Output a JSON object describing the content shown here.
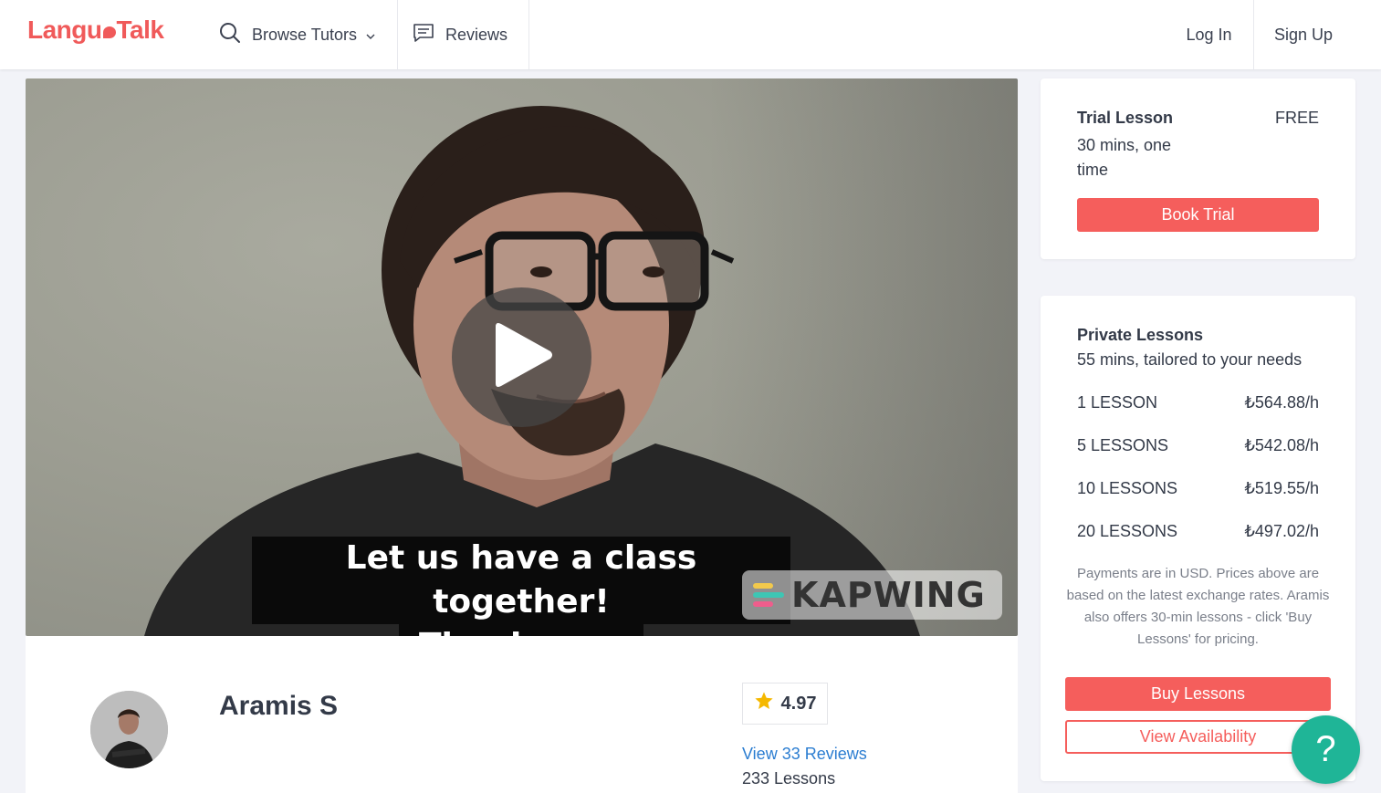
{
  "header": {
    "logo_pre": "Langu",
    "logo_post": "Talk",
    "browse_label": "Browse Tutors",
    "reviews_label": "Reviews",
    "login_label": "Log In",
    "signup_label": "Sign Up"
  },
  "video": {
    "caption_line1": "Let us have a class together!",
    "caption_line2": "Thank you.",
    "watermark": "KAPWING"
  },
  "tutor": {
    "name": "Aramis S",
    "rating": "4.97",
    "reviews_link": "View 33 Reviews",
    "lessons": "233 Lessons"
  },
  "trial": {
    "title": "Trial Lesson",
    "desc": "30 mins, one time",
    "price": "FREE",
    "button": "Book Trial"
  },
  "private": {
    "title": "Private Lessons",
    "desc": "55 mins, tailored to your needs",
    "prices": [
      {
        "label": "1 LESSON",
        "price": "₺564.88/h"
      },
      {
        "label": "5 LESSONS",
        "price": "₺542.08/h"
      },
      {
        "label": "10 LESSONS",
        "price": "₺519.55/h"
      },
      {
        "label": "20 LESSONS",
        "price": "₺497.02/h"
      }
    ],
    "note": "Payments are in USD. Prices above are based on the latest exchange rates. Aramis also offers 30-min lessons - click 'Buy Lessons' for pricing.",
    "buy_button": "Buy Lessons",
    "availability_button": "View Availability"
  },
  "help": {
    "label": "?"
  },
  "colors": {
    "brand": "#f05a5a",
    "button": "#f55e5c",
    "link": "#2b7dd1",
    "help": "#1fb597",
    "star": "#f5b800"
  }
}
